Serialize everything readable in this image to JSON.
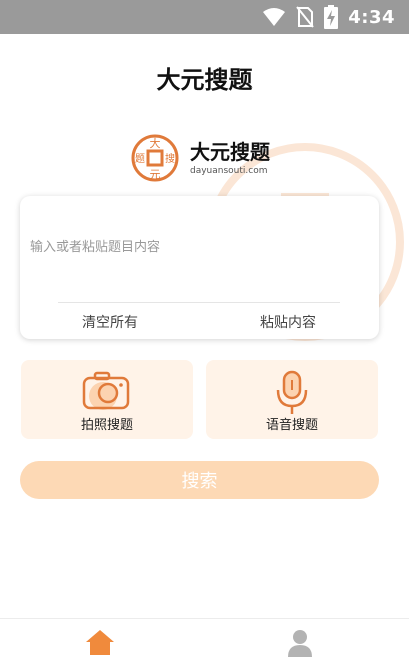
{
  "status_bar": {
    "time": "4:34",
    "icons": [
      "wifi-icon",
      "no-sim-icon",
      "battery-charging-icon"
    ]
  },
  "header": {
    "title": "大元搜题"
  },
  "brand": {
    "name": "大元搜题",
    "domain": "dayuansouti.com",
    "logo_text": [
      "大",
      "搜",
      "元",
      "题"
    ],
    "color": "#e07a3a"
  },
  "input_card": {
    "placeholder": "输入或者粘贴题目内容",
    "value": "",
    "clear_label": "清空所有",
    "paste_label": "粘贴内容"
  },
  "features": {
    "photo_label": "拍照搜题",
    "voice_label": "语音搜题"
  },
  "search": {
    "label": "搜索"
  },
  "bottom_nav": {
    "items": [
      {
        "icon": "home-icon",
        "active": true
      },
      {
        "icon": "user-icon",
        "active": false
      }
    ]
  },
  "colors": {
    "accent": "#f08a3c",
    "search_button": "#fdd9b5",
    "feature_bg": "#fff3e8",
    "status_bar": "#9a9a9a"
  }
}
